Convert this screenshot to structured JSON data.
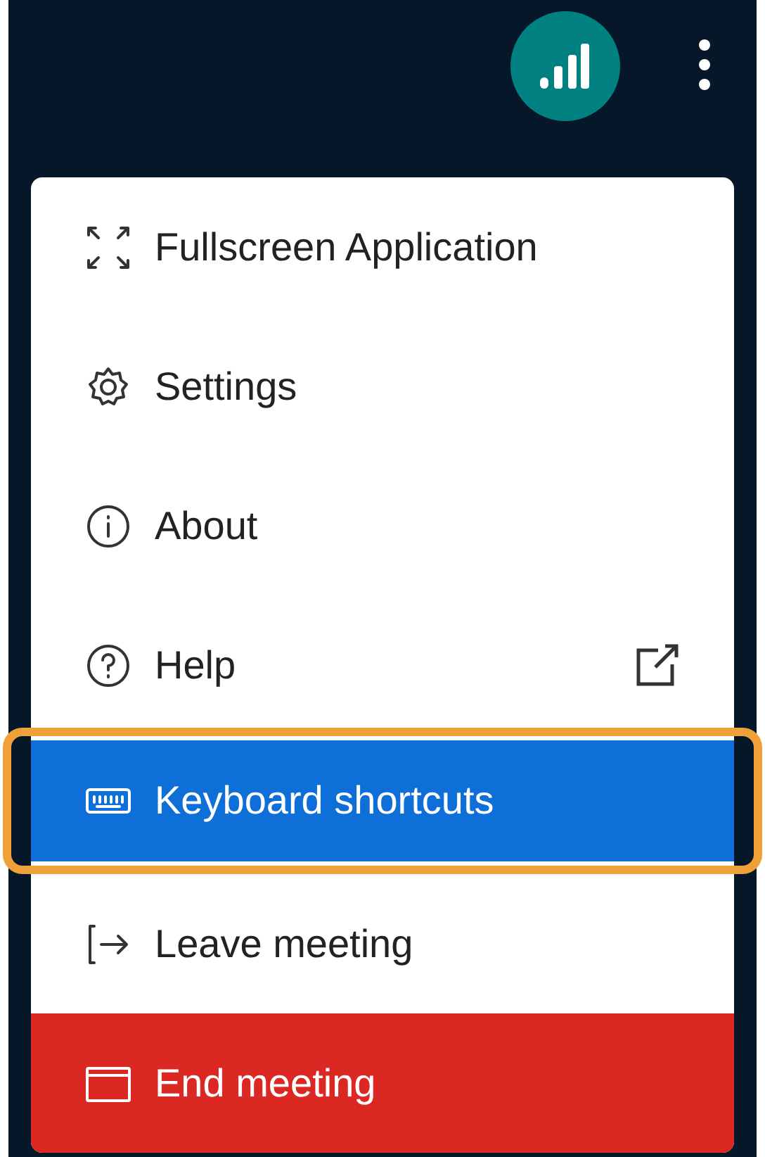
{
  "menu": {
    "items": [
      {
        "label": "Fullscreen Application",
        "kind": "normal",
        "selected": false,
        "focused": false,
        "external": false
      },
      {
        "label": "Settings",
        "kind": "normal",
        "selected": false,
        "focused": false,
        "external": false
      },
      {
        "label": "About",
        "kind": "normal",
        "selected": false,
        "focused": false,
        "external": false
      },
      {
        "label": "Help",
        "kind": "normal",
        "selected": false,
        "focused": false,
        "external": true
      },
      {
        "label": "Keyboard shortcuts",
        "kind": "normal",
        "selected": true,
        "focused": true,
        "external": false
      },
      {
        "label": "Leave meeting",
        "kind": "normal",
        "selected": false,
        "focused": false,
        "external": false
      },
      {
        "label": "End meeting",
        "kind": "danger",
        "selected": false,
        "focused": false,
        "external": false
      }
    ]
  }
}
